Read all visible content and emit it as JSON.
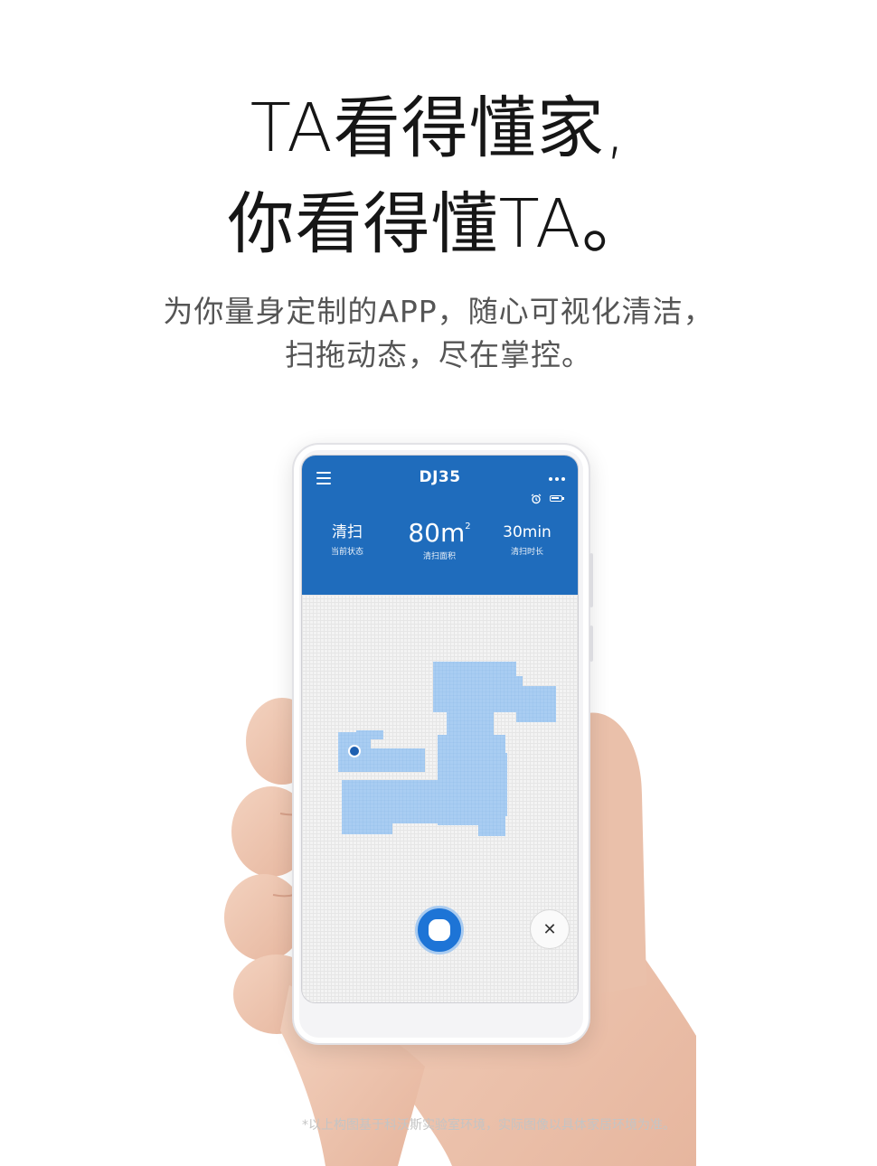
{
  "headline": {
    "line1": "TA看得懂家,",
    "line2": "你看得懂TA。"
  },
  "subheadline": {
    "line1": "为你量身定制的APP，随心可视化清洁，",
    "line2": "扫拖动态，尽在掌控。"
  },
  "app": {
    "title": "DJ35",
    "menu_icon": "hamburger-menu-icon",
    "more_icon": "more-dots-icon",
    "status_icons": [
      "alarm-clock-icon",
      "battery-icon"
    ],
    "stats": [
      {
        "value": "清扫",
        "label": "当前状态"
      },
      {
        "value": "80m",
        "superscript": "2",
        "label": "清扫面积"
      },
      {
        "value": "30min",
        "label": "清扫时长"
      }
    ],
    "start_button_icon": "stop-square-icon",
    "close_button_icon": "close-icon",
    "close_glyph": "✕"
  },
  "colors": {
    "header_blue": "#1f6cbc",
    "map_blue": "#a9cdf2",
    "robot_dot": "#1d5fb0",
    "button_blue": "#1d74d6"
  },
  "disclaimer": "*以上构图基于科沃斯实验室环境，实际图像以具体家居环境为准。"
}
